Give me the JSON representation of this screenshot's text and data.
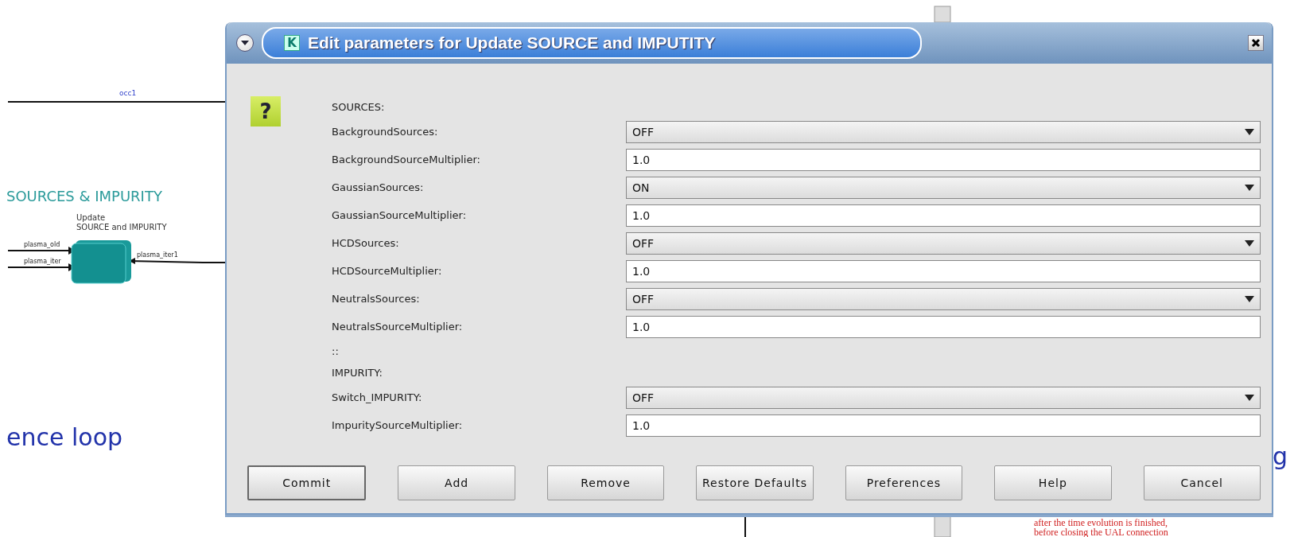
{
  "canvas": {
    "wire_label": "occ1",
    "group_title": "SOURCES & IMPURITY",
    "block_caption": [
      "Update",
      "SOURCE and IMPURITY"
    ],
    "ports_in": [
      "plasma_old",
      "plasma_iter"
    ],
    "port_out": "plasma_iter1",
    "loop_label": "ence loop",
    "cut_letter": "g",
    "note_lines": [
      "after the time evolution is finished,",
      "before closing the UAL connection"
    ]
  },
  "dialog": {
    "app_icon": "K",
    "title": "Edit parameters for Update SOURCE and IMPUTITY",
    "help_icon": "?",
    "rows": [
      {
        "kind": "header",
        "label": "SOURCES:"
      },
      {
        "kind": "select",
        "label": "BackgroundSources:",
        "value": "OFF"
      },
      {
        "kind": "text",
        "label": "BackgroundSourceMultiplier:",
        "value": "1.0"
      },
      {
        "kind": "select",
        "label": "GaussianSources:",
        "value": "ON"
      },
      {
        "kind": "text",
        "label": "GaussianSourceMultiplier:",
        "value": "1.0"
      },
      {
        "kind": "select",
        "label": "HCDSources:",
        "value": "OFF"
      },
      {
        "kind": "text",
        "label": "HCDSourceMultiplier:",
        "value": "1.0"
      },
      {
        "kind": "select",
        "label": "NeutralsSources:",
        "value": "OFF"
      },
      {
        "kind": "text",
        "label": "NeutralsSourceMultiplier:",
        "value": "1.0"
      },
      {
        "kind": "header",
        "label": "::"
      },
      {
        "kind": "header",
        "label": "IMPURITY:"
      },
      {
        "kind": "select",
        "label": "Switch_IMPURITY:",
        "value": "OFF"
      },
      {
        "kind": "text",
        "label": "ImpuritySourceMultiplier:",
        "value": "1.0"
      }
    ],
    "buttons": [
      {
        "label": "Commit",
        "default": true
      },
      {
        "label": "Add",
        "default": false
      },
      {
        "label": "Remove",
        "default": false
      },
      {
        "label": "Restore Defaults",
        "default": false
      },
      {
        "label": "Preferences",
        "default": false
      },
      {
        "label": "Help",
        "default": false
      },
      {
        "label": "Cancel",
        "default": false
      }
    ]
  }
}
